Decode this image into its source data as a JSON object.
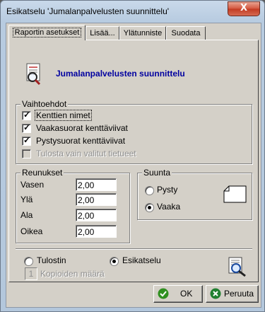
{
  "window": {
    "title": "Esikatselu 'Jumalanpalvelusten suunnittelu'",
    "close_label": "X"
  },
  "tabs": [
    {
      "label": "Raportin asetukset",
      "active": true
    },
    {
      "label": "Lisää...",
      "active": false
    },
    {
      "label": "Ylätunniste",
      "active": false
    },
    {
      "label": "Suodata",
      "active": false
    }
  ],
  "report": {
    "title": "Jumalanpalvelusten suunnittelu",
    "icon": "report-magnifier-icon"
  },
  "options": {
    "group_label": "Vaihtoehdot",
    "items": [
      {
        "label": "Kenttien nimet",
        "checked": true,
        "enabled": true
      },
      {
        "label": "Vaakasuorat kenttäviivat",
        "checked": true,
        "enabled": true
      },
      {
        "label": "Pystysuorat kenttäviivat",
        "checked": true,
        "enabled": true
      },
      {
        "label": "Tulosta vain valitut tietueet",
        "checked": false,
        "enabled": false
      }
    ]
  },
  "margins": {
    "group_label": "Reunukset",
    "fields": [
      {
        "label": "Vasen",
        "value": "2,00"
      },
      {
        "label": "Ylä",
        "value": "2,00"
      },
      {
        "label": "Ala",
        "value": "2,00"
      },
      {
        "label": "Oikea",
        "value": "2,00"
      }
    ]
  },
  "orientation": {
    "group_label": "Suunta",
    "options": [
      {
        "label": "Pysty",
        "selected": false
      },
      {
        "label": "Vaaka",
        "selected": true
      }
    ],
    "icon": "landscape-page-icon"
  },
  "output": {
    "options": [
      {
        "label": "Tulostin",
        "selected": false
      },
      {
        "label": "Esikatselu",
        "selected": true
      }
    ],
    "copies_value": "1",
    "copies_label": "Kopioiden määrä",
    "preview_icon": "print-preview-icon"
  },
  "buttons": {
    "ok_label": "OK",
    "cancel_label": "Peruuta"
  },
  "colors": {
    "accent_title": "#0000a0",
    "ok_icon": "#2f8f1f",
    "cancel_icon": "#1f7f2f"
  }
}
